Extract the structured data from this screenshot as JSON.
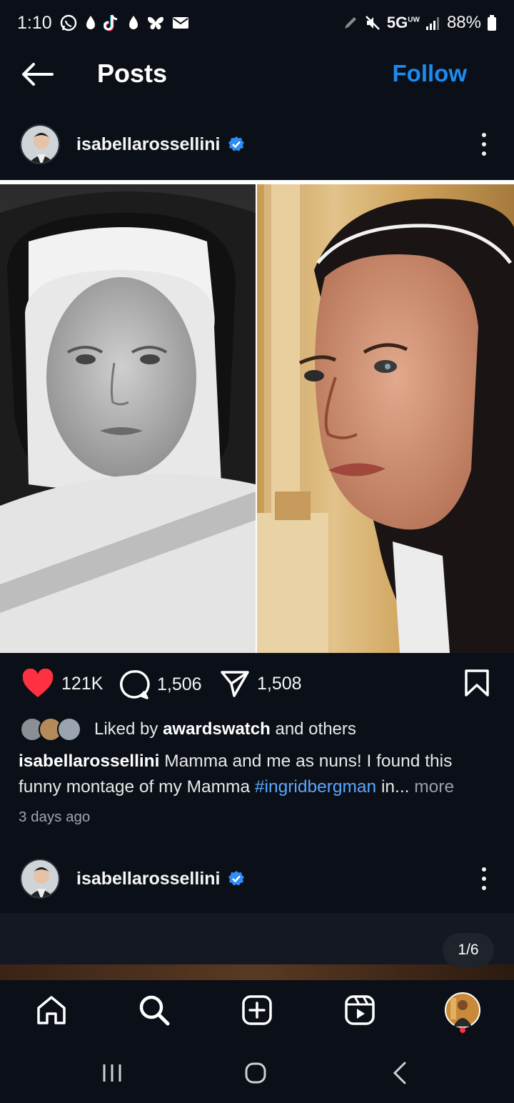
{
  "status_bar": {
    "time": "1:10",
    "network": "5G",
    "network_sub": "UW",
    "battery": "88%"
  },
  "topbar": {
    "title": "Posts",
    "follow_label": "Follow"
  },
  "post": {
    "username": "isabellarossellini",
    "likes": "121K",
    "comments": "1,506",
    "shares": "1,508",
    "liked_by_prefix": "Liked by ",
    "liked_by_user": "awardswatch",
    "liked_by_suffix": " and others",
    "caption_user": "isabellarossellini",
    "caption_text": " Mamma and me as nuns! I found this funny montage of my Mamma ",
    "caption_hashtag": "#ingridbergman",
    "caption_tail": " in...",
    "caption_more": " more",
    "timestamp": "3 days ago"
  },
  "next_post": {
    "username": "isabellarossellini",
    "counter": "1/6"
  },
  "colors": {
    "accent": "#1a8cf0",
    "like": "#ff3040",
    "verified": "#2f8df5",
    "hashtag": "#5aa7ff"
  },
  "icons": {
    "back": "arrow-left-icon",
    "verified": "verified-badge-icon",
    "like": "heart-filled-icon",
    "comment": "comment-icon",
    "share": "paper-plane-icon",
    "save": "bookmark-icon",
    "nav": [
      "home-icon",
      "search-icon",
      "create-icon",
      "reels-icon",
      "profile-avatar"
    ]
  }
}
